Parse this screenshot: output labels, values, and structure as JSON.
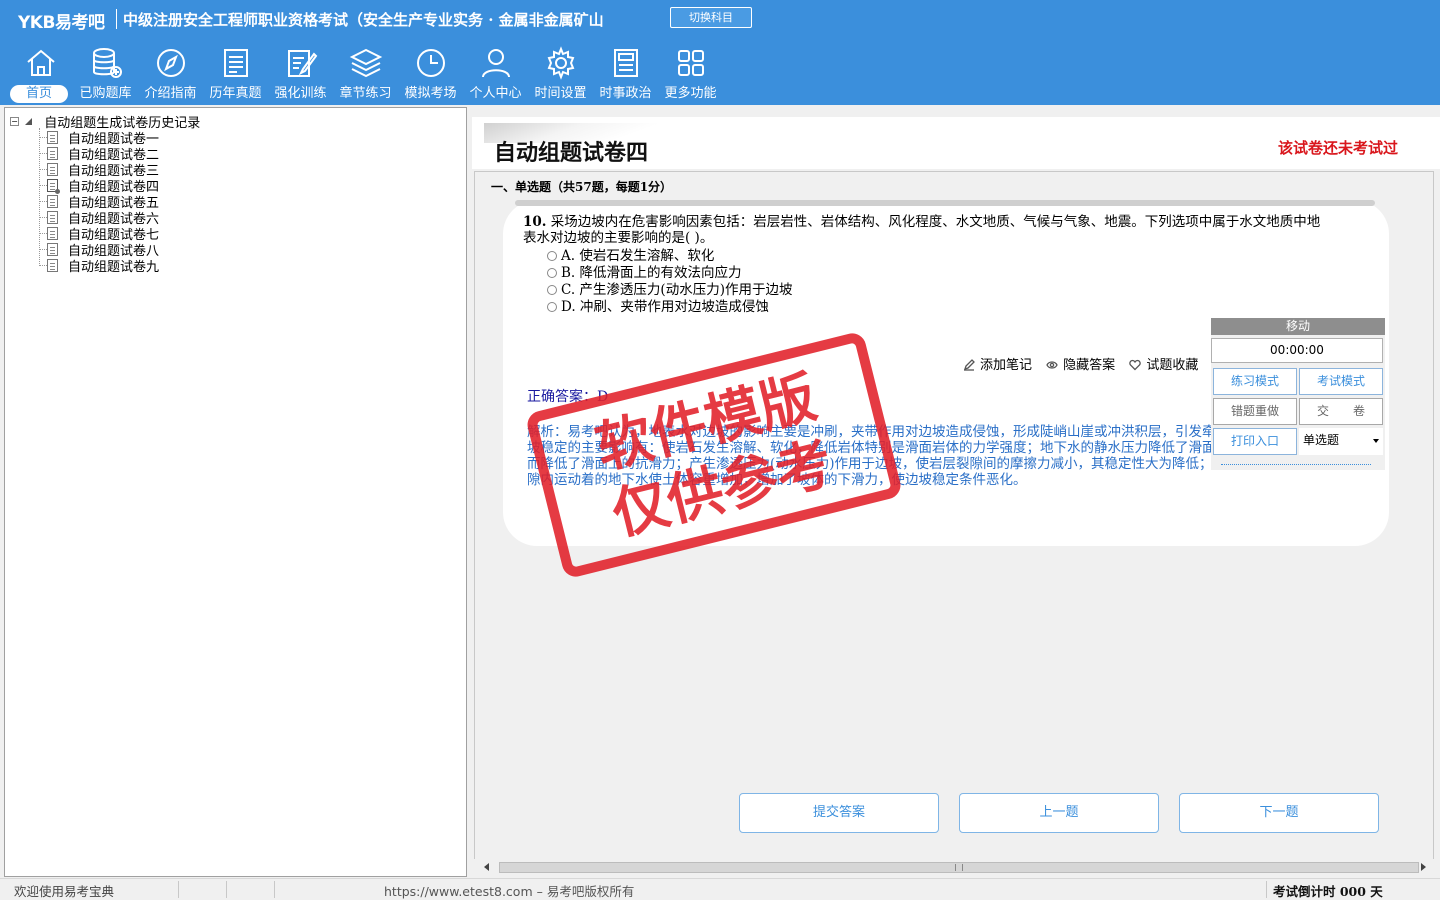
{
  "header": {
    "logo": "YKB易考吧",
    "exam_title": "中级注册安全工程师职业资格考试（安全生产专业实务 · 金属非金属矿山",
    "switch_label": "切换科目"
  },
  "nav": [
    {
      "label": "首页",
      "icon": "home-icon"
    },
    {
      "label": "已购题库",
      "icon": "database-icon"
    },
    {
      "label": "介绍指南",
      "icon": "compass-icon"
    },
    {
      "label": "历年真题",
      "icon": "list-doc-icon"
    },
    {
      "label": "强化训练",
      "icon": "edit-doc-icon"
    },
    {
      "label": "章节练习",
      "icon": "layers-icon"
    },
    {
      "label": "模拟考场",
      "icon": "clock-icon"
    },
    {
      "label": "个人中心",
      "icon": "user-icon"
    },
    {
      "label": "时间设置",
      "icon": "gear-icon"
    },
    {
      "label": "时事政治",
      "icon": "newspaper-icon"
    },
    {
      "label": "更多功能",
      "icon": "grid-icon"
    }
  ],
  "tree": {
    "root": "自动组题生成试卷历史记录",
    "items": [
      "自动组题试卷一",
      "自动组题试卷二",
      "自动组题试卷三",
      "自动组题试卷四",
      "自动组题试卷五",
      "自动组题试卷六",
      "自动组题试卷七",
      "自动组题试卷八",
      "自动组题试卷九"
    ]
  },
  "paper": {
    "title": "自动组题试卷四",
    "status": "该试卷还未考试过",
    "section": "一、单选题（共57题，每题1分）"
  },
  "question": {
    "number": "10.",
    "text": "采场边坡内在危害影响因素包括：岩层岩性、岩体结构、风化程度、水文地质、气候与气象、地震。下列选项中属于水文地质中地表水对边坡的主要影响的是( )。",
    "options": [
      "A. 使岩石发生溶解、软化",
      "B. 降低滑面上的有效法向应力",
      "C. 产生渗透压力(动水压力)作用于边坡",
      "D. 冲刷、夹带作用对边坡造成侵蚀"
    ],
    "tools": {
      "note": "添加笔记",
      "hide": "隐藏答案",
      "fav": "试题收藏"
    },
    "answer": "正确答案：D",
    "analysis": "解析：易考吧认为，地表水对边坡的影响主要是冲刷，夹带作用对边坡造成侵蚀，形成陡峭山崖或冲洪积层，引发牵引式滑坡。地下水对边坡稳定的主要影响有：使岩石发生溶解、软化，降低岩体特别是滑面岩体的力学强度；地下水的静水压力降低了滑面上的有效法向应力，从而降低了滑面上的抗滑力；产生渗透压力(动水压力)作用于边坡，使岩层裂隙间的摩擦力减小，其稳定性大为降低；在边坡岩体的孔隙和裂隙内运动着的地下水使土体容重增加，增加了坡体的下滑力，使边坡稳定条件恶化。"
  },
  "control": {
    "move": "移动",
    "timer": "00:00:00",
    "practice_mode": "练习模式",
    "exam_mode": "考试模式",
    "redo_wrong": "错题重做",
    "submit_paper": "交　　卷",
    "print": "打印入口",
    "type_select": "单选题"
  },
  "stamp": {
    "line1": "软件模版",
    "line2": "仅供参考"
  },
  "buttons": {
    "submit": "提交答案",
    "prev": "上一题",
    "next": "下一题"
  },
  "statusbar": {
    "welcome": "欢迎使用易考宝典",
    "site": "https://www.etest8.com – 易考吧版权所有",
    "countdown": "考试倒计时 000 天"
  },
  "colors": {
    "brand": "#3b8fdc",
    "status_red": "#d9161c",
    "answer_blue": "#1a1aa0",
    "analysis_blue": "#2a6fc7",
    "stamp_red": "#e2202a"
  }
}
